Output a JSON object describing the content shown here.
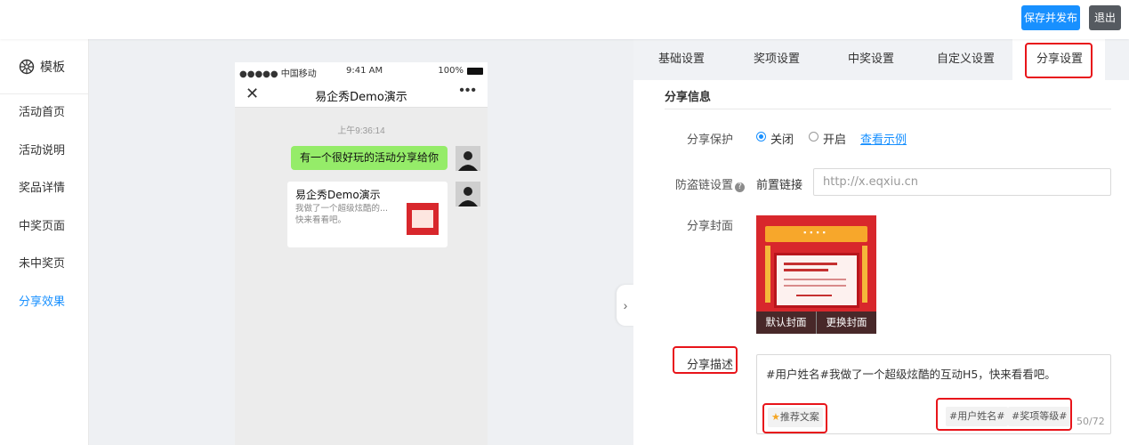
{
  "topbar": {
    "publish_label": "保存并发布",
    "exit_label": "退出"
  },
  "sidebar": {
    "header": "模板",
    "items": [
      {
        "label": "活动首页"
      },
      {
        "label": "活动说明"
      },
      {
        "label": "奖品详情"
      },
      {
        "label": "中奖页面"
      },
      {
        "label": "未中奖页"
      },
      {
        "label": "分享效果",
        "active": true
      }
    ]
  },
  "phone": {
    "carrier": "●●●●● 中国移动",
    "time": "9:41 AM",
    "battery": "100%",
    "nav_title": "易企秀Demo演示",
    "chat_time": "上午9:36:14",
    "message": "有一个很好玩的活动分享给你",
    "card": {
      "title": "易企秀Demo演示",
      "desc": "我做了一个超级炫酷的... 快来看看吧。"
    }
  },
  "tabs": [
    {
      "label": "基础设置"
    },
    {
      "label": "奖项设置"
    },
    {
      "label": "中奖设置"
    },
    {
      "label": "自定义设置"
    },
    {
      "label": "分享设置",
      "active": true
    }
  ],
  "form": {
    "section_title": "分享信息",
    "protection_label": "分享保护",
    "option_off": "关闭",
    "option_on": "开启",
    "protection_value": "关闭",
    "example_link": "查看示例",
    "antileech_label": "防盗链设置",
    "prefix_label": "前置链接",
    "url_placeholder": "http://x.eqxiu.cn",
    "cover_label": "分享封面",
    "cover_default": "默认封面",
    "cover_change": "更换封面",
    "desc_label": "分享描述",
    "desc_value": "#用户姓名#我做了一个超级炫酷的互动H5，快来看看吧。",
    "recommend": "推荐文案",
    "tag_name": "#用户姓名#",
    "tag_level": "#奖项等级#",
    "counter": "50/72"
  },
  "colors": {
    "primary": "#1890ff",
    "highlight": "#e8141a",
    "bubble": "#95ec69"
  }
}
